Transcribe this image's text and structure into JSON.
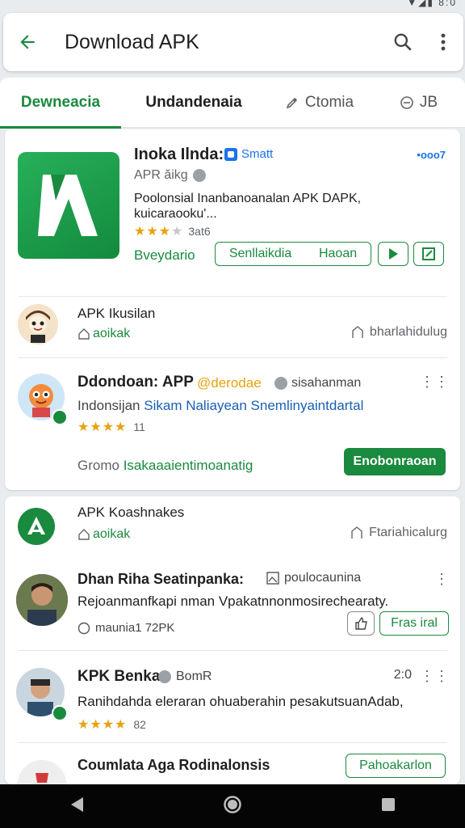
{
  "status": {
    "icons": "▼◢▮ 8:0"
  },
  "topbar": {
    "title": "Download APK"
  },
  "tabs": [
    {
      "label": "Dewneacia"
    },
    {
      "label": "Undandenaia"
    },
    {
      "label": "Ctomia"
    },
    {
      "label": "JB"
    }
  ],
  "featured": {
    "title": "Inoka Ilnda:",
    "badge": "Smatt",
    "more": "•ooo7",
    "subtitle": "APR ăikg",
    "description": "Poolonsial Inanbanoanalan APK DAPK, kuicaraooku'...",
    "rating_text": "3at6",
    "rating_stars": 3,
    "label": "Bveydario",
    "button_left": "Senllaikdia",
    "button_right": "Haoan"
  },
  "rows": [
    {
      "title": "APK Ikusilan",
      "sub": "aoikak",
      "right": "bharlahidulug"
    },
    {
      "title": "APK Koashnakes",
      "sub": "aoikak",
      "right": "Ftariahicalurg"
    }
  ],
  "app2": {
    "title": "Ddondoan: APP",
    "tag": "@derodae",
    "badge": "sisahanman",
    "desc_dark": "Indonsijan",
    "desc": "Sikam Naliayean Snemlinyaintdartal",
    "rating_count": "11",
    "foot_grey": "Gromo",
    "foot": "Isakaaaientimoanatig",
    "button": "Enobonraoan"
  },
  "app3": {
    "title": "Dhan Riha Seatinpanka:",
    "badge": "poulocaunina",
    "desc": "Rejoanmanfkapi nman Vpakatnnonmosirechearaty.",
    "meta": "maunia1 72PK",
    "button": "Fras iral"
  },
  "app4": {
    "title": "KPK Benka",
    "badge": "BomR",
    "count": "2:0",
    "desc": "Ranihdahda eleraran ohuaberahin pesakutsuanAdab,",
    "rating_count": "82"
  },
  "app5": {
    "title": "Coumlata Aga Rodinalonsis",
    "button": "Pahoakarlon"
  },
  "colors": {
    "accent": "#1a8a3e",
    "link": "#1a73e8",
    "star": "#e6a20f"
  }
}
